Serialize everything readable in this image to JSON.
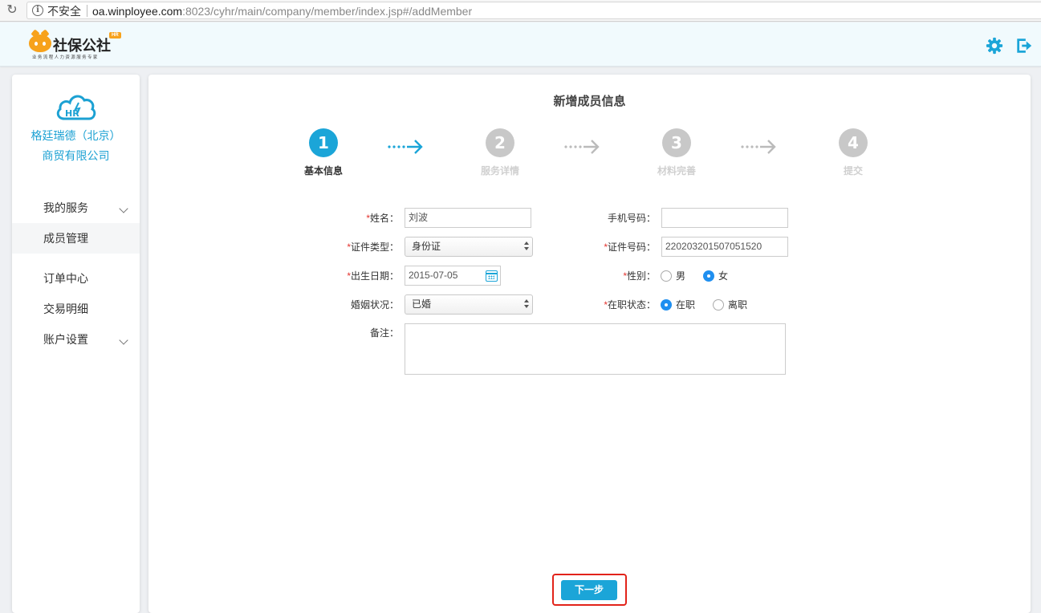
{
  "browser": {
    "insecure_label": "不安全",
    "url_host": "oa.winployee.com",
    "url_rest": ":8023/cyhr/main/company/member/index.jsp#/addMember"
  },
  "header": {
    "logo_title": "社保公社",
    "logo_badge": "HR",
    "logo_subtitle": "业务流程人力资源服务专家",
    "icons": [
      "gear-icon",
      "logout-icon"
    ],
    "accent_color": "#1ba5d8"
  },
  "sidebar": {
    "company_name": "格廷瑞德（北京）商贸有限公司",
    "items": [
      {
        "label": "我的服务",
        "expandable": true
      },
      {
        "label": "成员管理",
        "active": true
      },
      {
        "label": "订单中心"
      },
      {
        "label": "交易明细"
      },
      {
        "label": "账户设置",
        "expandable": true
      }
    ]
  },
  "main": {
    "title": "新增成员信息",
    "steps": [
      {
        "number": "1",
        "label": "基本信息",
        "active": true
      },
      {
        "number": "2",
        "label": "服务详情"
      },
      {
        "number": "3",
        "label": "材料完善"
      },
      {
        "number": "4",
        "label": "提交"
      }
    ],
    "form": {
      "name_label": "姓名：",
      "name_value": "刘波",
      "phone_label": "手机号码：",
      "phone_value": "",
      "idtype_label": "证件类型：",
      "idtype_value": "身份证",
      "idnumber_label": "证件号码：",
      "idnumber_value": "220203201507051520",
      "birth_label": "出生日期：",
      "birth_value": "2015-07-05",
      "gender_label": "性别：",
      "gender_male": "男",
      "gender_female": "女",
      "gender_selected": "女",
      "marital_label": "婚姻状况：",
      "marital_value": "已婚",
      "employment_label": "在职状态：",
      "employment_on": "在职",
      "employment_off": "离职",
      "employment_selected": "在职",
      "remark_label": "备注：",
      "remark_value": "",
      "required_mark": "*"
    },
    "next_button": "下一步"
  }
}
